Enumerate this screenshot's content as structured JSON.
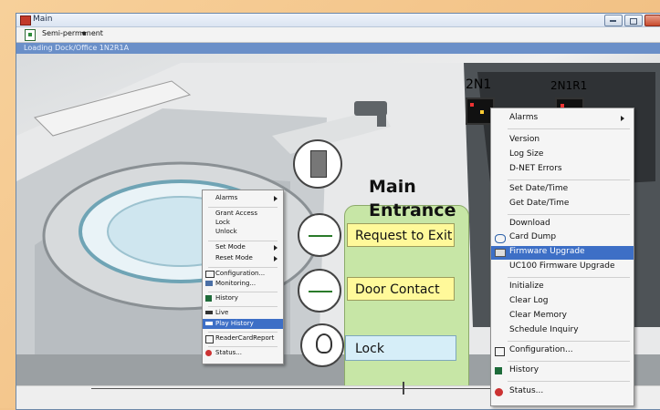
{
  "window": {
    "title": "Main"
  },
  "toolbar": {
    "mode": "Semi-permanent"
  },
  "location_bar": {
    "path": "Loading Dock/Office 1N2R1A"
  },
  "controllers": [
    {
      "label": "2N1"
    },
    {
      "label": "2N1R1"
    }
  ],
  "door": {
    "name_line1": "Main",
    "name_line2": "Entrance",
    "request_to_exit": "Request to Exit",
    "door_contact": "Door Contact",
    "lock": "Lock"
  },
  "small_menu": {
    "items": [
      "Alarms",
      "Grant Access",
      "Lock",
      "Unlock",
      "Set Mode",
      "Reset Mode",
      "Configuration...",
      "Monitoring...",
      "History",
      "Live",
      "Play History",
      "ReaderCardReport",
      "Status..."
    ],
    "highlighted": "Play History"
  },
  "large_menu": {
    "items": [
      "Alarms",
      "Version",
      "Log Size",
      "D-NET Errors",
      "Set Date/Time",
      "Get Date/Time",
      "Download",
      "Card Dump",
      "Firmware Upgrade",
      "UC100 Firmware Upgrade",
      "Initialize",
      "Clear Log",
      "Clear Memory",
      "Schedule Inquiry",
      "Configuration...",
      "History",
      "Status..."
    ],
    "highlighted": "Firmware Upgrade"
  },
  "colors": {
    "accent": "#3d6fc6",
    "panel_green": "#c7e6a6",
    "label_yellow": "#fff99a",
    "label_blue": "#d6eef8"
  }
}
